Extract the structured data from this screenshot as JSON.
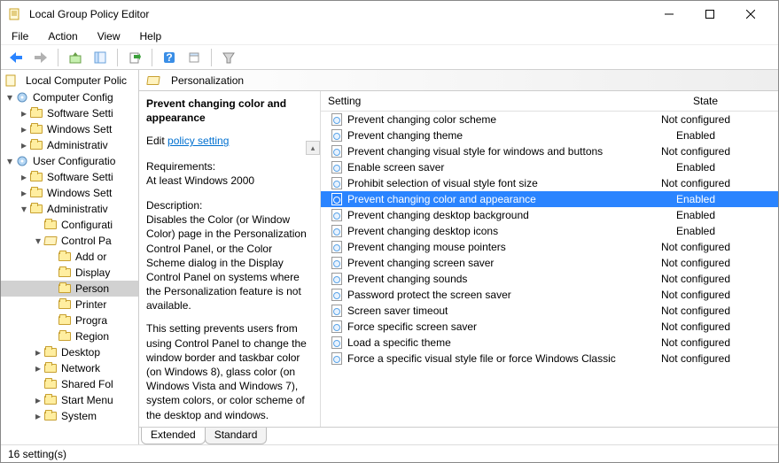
{
  "window": {
    "title": "Local Group Policy Editor"
  },
  "menu": {
    "file": "File",
    "action": "Action",
    "view": "View",
    "help": "Help"
  },
  "tree_header": "Local Computer Polic",
  "tree": [
    {
      "depth": 0,
      "twisty": "▾",
      "icon": "gear",
      "label": "Computer Config"
    },
    {
      "depth": 1,
      "twisty": "▸",
      "icon": "folder",
      "label": "Software Setti"
    },
    {
      "depth": 1,
      "twisty": "▸",
      "icon": "folder",
      "label": "Windows Sett"
    },
    {
      "depth": 1,
      "twisty": "▸",
      "icon": "folder",
      "label": "Administrativ"
    },
    {
      "depth": 0,
      "twisty": "▾",
      "icon": "gear",
      "label": "User Configuratio"
    },
    {
      "depth": 1,
      "twisty": "▸",
      "icon": "folder",
      "label": "Software Setti"
    },
    {
      "depth": 1,
      "twisty": "▸",
      "icon": "folder",
      "label": "Windows Sett"
    },
    {
      "depth": 1,
      "twisty": "▾",
      "icon": "folder",
      "label": "Administrativ"
    },
    {
      "depth": 2,
      "twisty": "",
      "icon": "folder",
      "label": "Configurati"
    },
    {
      "depth": 2,
      "twisty": "▾",
      "icon": "folder-open",
      "label": "Control Pa"
    },
    {
      "depth": 3,
      "twisty": "",
      "icon": "folder",
      "label": "Add or"
    },
    {
      "depth": 3,
      "twisty": "",
      "icon": "folder",
      "label": "Display"
    },
    {
      "depth": 3,
      "twisty": "",
      "icon": "folder",
      "label": "Person",
      "selected": true
    },
    {
      "depth": 3,
      "twisty": "",
      "icon": "folder",
      "label": "Printer"
    },
    {
      "depth": 3,
      "twisty": "",
      "icon": "folder",
      "label": "Progra"
    },
    {
      "depth": 3,
      "twisty": "",
      "icon": "folder",
      "label": "Region"
    },
    {
      "depth": 2,
      "twisty": "▸",
      "icon": "folder",
      "label": "Desktop"
    },
    {
      "depth": 2,
      "twisty": "▸",
      "icon": "folder",
      "label": "Network"
    },
    {
      "depth": 2,
      "twisty": "",
      "icon": "folder",
      "label": "Shared Fol"
    },
    {
      "depth": 2,
      "twisty": "▸",
      "icon": "folder",
      "label": "Start Menu"
    },
    {
      "depth": 2,
      "twisty": "▸",
      "icon": "folder",
      "label": "System"
    }
  ],
  "path_header": "Personalization",
  "desc": {
    "title": "Prevent changing color and appearance",
    "edit_prefix": "Edit ",
    "edit_link": "policy setting",
    "req_lbl": "Requirements:",
    "req_val": "At least Windows 2000",
    "desc_lbl": "Description:",
    "desc_p1": "Disables the Color (or Window Color) page in the Personalization Control Panel, or the Color Scheme dialog in the Display Control Panel on systems where the Personalization feature is not available.",
    "desc_p2": "This setting prevents users from using Control Panel to change the window border and taskbar color (on Windows 8), glass color (on Windows Vista and Windows 7), system colors, or color scheme of the desktop and windows."
  },
  "columns": {
    "setting": "Setting",
    "state": "State"
  },
  "settings": [
    {
      "name": "Prevent changing color scheme",
      "state": "Not configured"
    },
    {
      "name": "Prevent changing theme",
      "state": "Enabled"
    },
    {
      "name": "Prevent changing visual style for windows and buttons",
      "state": "Not configured"
    },
    {
      "name": "Enable screen saver",
      "state": "Enabled"
    },
    {
      "name": "Prohibit selection of visual style font size",
      "state": "Not configured"
    },
    {
      "name": "Prevent changing color and appearance",
      "state": "Enabled",
      "selected": true
    },
    {
      "name": "Prevent changing desktop background",
      "state": "Enabled"
    },
    {
      "name": "Prevent changing desktop icons",
      "state": "Enabled"
    },
    {
      "name": "Prevent changing mouse pointers",
      "state": "Not configured"
    },
    {
      "name": "Prevent changing screen saver",
      "state": "Not configured"
    },
    {
      "name": "Prevent changing sounds",
      "state": "Not configured"
    },
    {
      "name": "Password protect the screen saver",
      "state": "Not configured"
    },
    {
      "name": "Screen saver timeout",
      "state": "Not configured"
    },
    {
      "name": "Force specific screen saver",
      "state": "Not configured"
    },
    {
      "name": "Load a specific theme",
      "state": "Not configured"
    },
    {
      "name": "Force a specific visual style file or force Windows Classic",
      "state": "Not configured"
    }
  ],
  "tabs": {
    "extended": "Extended",
    "standard": "Standard"
  },
  "status": "16 setting(s)"
}
